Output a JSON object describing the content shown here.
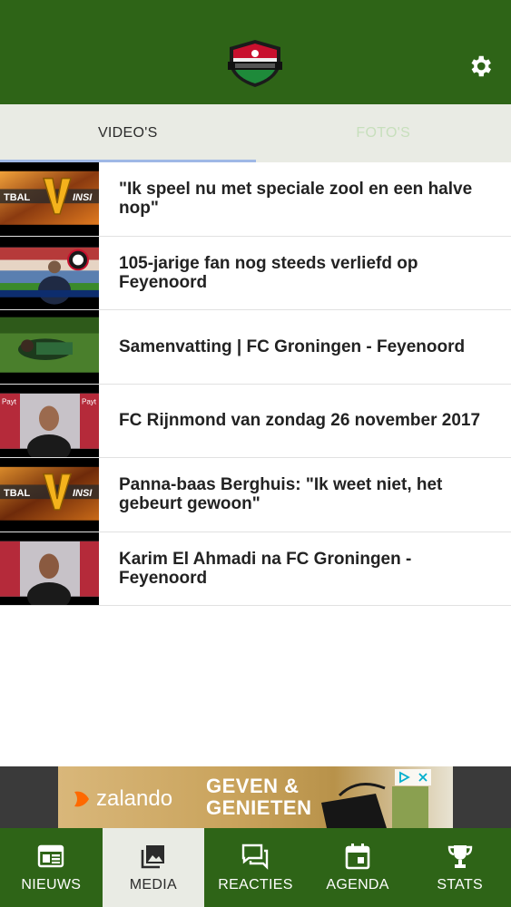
{
  "header": {
    "logo_icon": "club-shield-logo-icon",
    "settings_icon": "gear-icon"
  },
  "tabs": [
    {
      "label": "VIDEO'S",
      "active": true
    },
    {
      "label": "FOTO'S",
      "active": false
    }
  ],
  "videos": [
    {
      "title": "\"Ik speel nu met speciale zool en een halve nop\"",
      "thumb": "studio-logo-v"
    },
    {
      "title": "105-jarige fan nog steeds verliefd op Feyenoord",
      "thumb": "stadium-interview"
    },
    {
      "title": "Samenvatting | FC Groningen - Feyenoord",
      "thumb": "match-pitch"
    },
    {
      "title": "FC Rijnmond van zondag 26 november 2017",
      "thumb": "press-interview"
    },
    {
      "title": "Panna-baas Berghuis: \"Ik weet niet, het gebeurt gewoon\"",
      "thumb": "studio-logo-v"
    },
    {
      "title": "Karim El Ahmadi na FC Groningen - Feyenoord",
      "thumb": "press-interview"
    }
  ],
  "ad": {
    "brand": "zalando",
    "headline_line1": "GEVEN &",
    "headline_line2": "GENIETEN",
    "adchoices_icon": "adchoices-icon",
    "close_icon": "close-icon"
  },
  "bottom_nav": [
    {
      "label": "NIEUWS",
      "icon": "newspaper-icon",
      "active": false
    },
    {
      "label": "MEDIA",
      "icon": "photo-gallery-icon",
      "active": true
    },
    {
      "label": "REACTIES",
      "icon": "chat-bubbles-icon",
      "active": false
    },
    {
      "label": "AGENDA",
      "icon": "calendar-icon",
      "active": false
    },
    {
      "label": "STATS",
      "icon": "trophy-icon",
      "active": false
    }
  ],
  "colors": {
    "brand_green": "#2e6417",
    "tab_bg": "#e9ebe4",
    "tab_indicator": "#9fb8e6",
    "inactive_tab_text": "#c7dfbc"
  }
}
